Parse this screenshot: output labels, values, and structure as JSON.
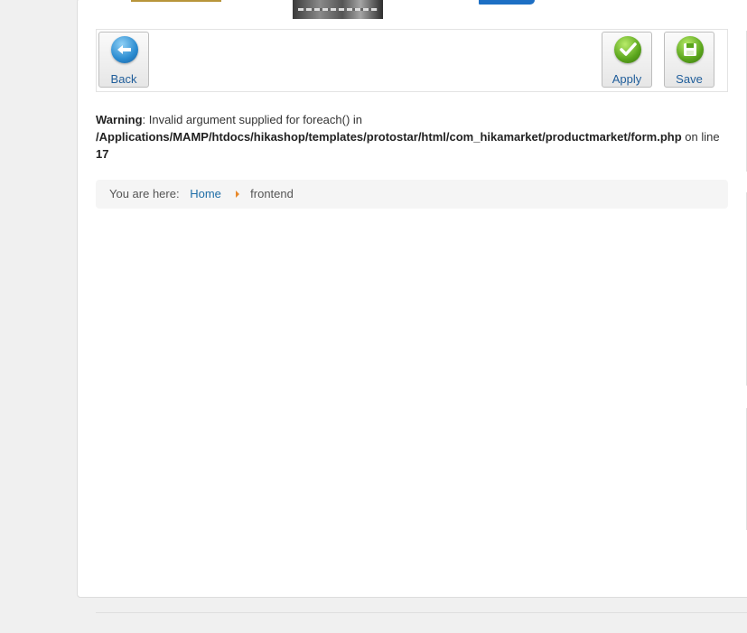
{
  "toolbar": {
    "back_label": "Back",
    "apply_label": "Apply",
    "save_label": "Save"
  },
  "warning": {
    "label": "Warning",
    "message": ": Invalid argument supplied for foreach() in ",
    "path": "/Applications/MAMP/htdocs/hikashop/templates/protostar/html/com_hikamarket/productmarket/form.php",
    "on_line_text": " on line ",
    "line_number": "17"
  },
  "breadcrumb": {
    "prefix": "You are here:",
    "home": "Home",
    "current": "frontend"
  },
  "icons": {
    "back": "back-arrow-icon",
    "apply": "checkmark-icon",
    "save": "floppy-disk-icon",
    "divider": "caret-right-icon"
  },
  "colors": {
    "link": "#1f6ea7",
    "divider_accent": "#e8892b",
    "breadcrumb_bg": "#f5f5f5",
    "page_bg": "#f0f0f0"
  }
}
